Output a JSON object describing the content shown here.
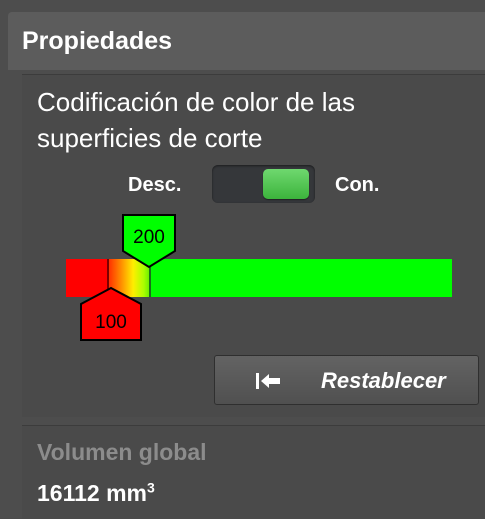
{
  "panel": {
    "title": "Propiedades"
  },
  "color_coding": {
    "title": "Codificación de color de las superficies de corte",
    "toggle": {
      "off_label": "Desc.",
      "on_label": "Con.",
      "state": "on",
      "on_color": "#4cc64c"
    },
    "scale": {
      "colors": [
        "#ff0000",
        "#ffee00",
        "#00ff00"
      ],
      "low_marker": {
        "value": "100",
        "color": "#ff0000"
      },
      "high_marker": {
        "value": "200",
        "color": "#00ff00"
      }
    },
    "reset_button": {
      "icon": "reset-to-start-icon",
      "label": "Restablecer"
    }
  },
  "volume": {
    "label": "Volumen global",
    "value": "16112 mm",
    "unit_superscript": "3"
  }
}
